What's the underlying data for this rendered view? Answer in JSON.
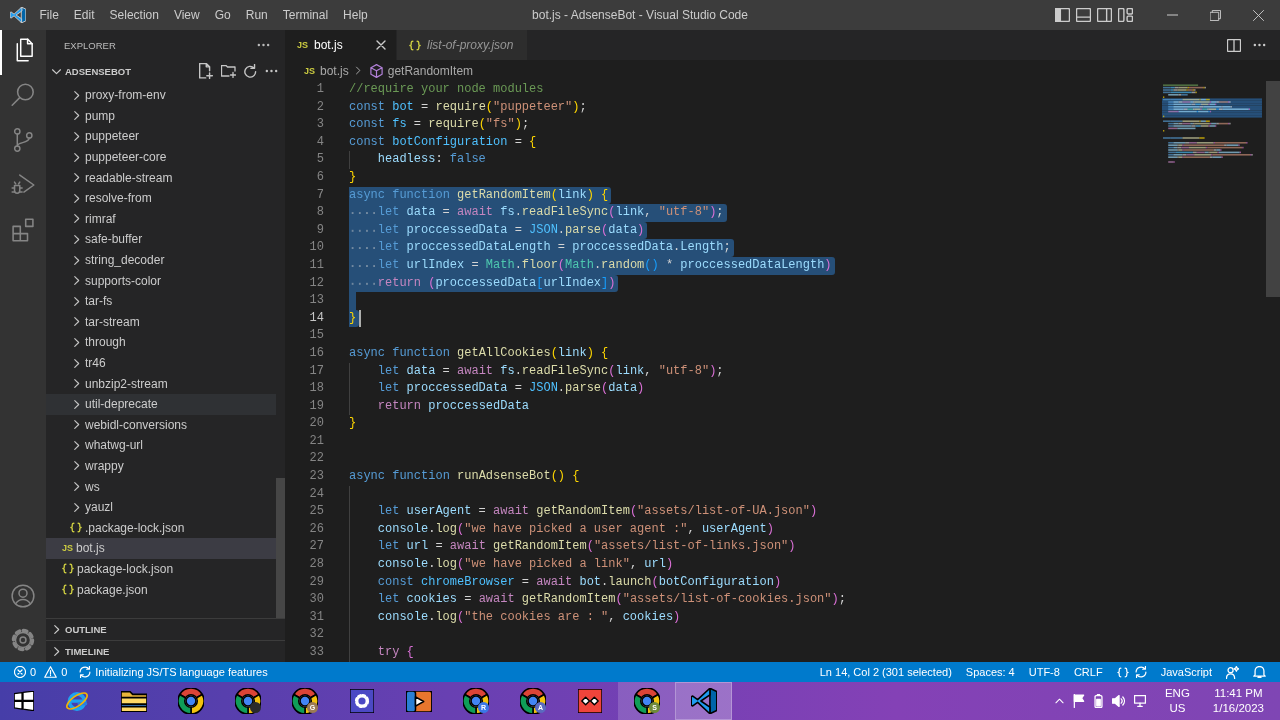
{
  "window": {
    "title": "bot.js - AdsenseBot - Visual Studio Code"
  },
  "menu": [
    "File",
    "Edit",
    "Selection",
    "View",
    "Go",
    "Run",
    "Terminal",
    "Help"
  ],
  "activity_bar": {
    "top": [
      {
        "kind": "explorer",
        "selected": true
      },
      {
        "kind": "search",
        "selected": false
      },
      {
        "kind": "source-control",
        "selected": false
      },
      {
        "kind": "run-debug",
        "selected": false
      },
      {
        "kind": "extensions",
        "selected": false
      }
    ],
    "bottom": [
      {
        "kind": "accounts",
        "selected": false
      },
      {
        "kind": "manage",
        "selected": false
      }
    ]
  },
  "sidebar": {
    "title": "EXPLORER",
    "sections": [
      {
        "title": "ADSENSEBOT",
        "expanded": true,
        "tree": [
          {
            "kind": "scrolled-parent",
            "children": [
              {
                "kind": "folder",
                "label": "proxy-from-env",
                "expanded": false,
                "selected": false,
                "hovered": false
              },
              {
                "kind": "folder",
                "label": "pump",
                "expanded": false,
                "selected": false,
                "hovered": false
              },
              {
                "kind": "folder",
                "label": "puppeteer",
                "expanded": false,
                "selected": false,
                "hovered": false
              },
              {
                "kind": "folder",
                "label": "puppeteer-core",
                "expanded": false,
                "selected": false,
                "hovered": false
              },
              {
                "kind": "folder",
                "label": "readable-stream",
                "expanded": false,
                "selected": false,
                "hovered": false
              },
              {
                "kind": "folder",
                "label": "resolve-from",
                "expanded": false,
                "selected": false,
                "hovered": false
              },
              {
                "kind": "folder",
                "label": "rimraf",
                "expanded": false,
                "selected": false,
                "hovered": false
              },
              {
                "kind": "folder",
                "label": "safe-buffer",
                "expanded": false,
                "selected": false,
                "hovered": false
              },
              {
                "kind": "folder",
                "label": "string_decoder",
                "expanded": false,
                "selected": false,
                "hovered": false
              },
              {
                "kind": "folder",
                "label": "supports-color",
                "expanded": false,
                "selected": false,
                "hovered": false
              },
              {
                "kind": "folder",
                "label": "tar-fs",
                "expanded": false,
                "selected": false,
                "hovered": false
              },
              {
                "kind": "folder",
                "label": "tar-stream",
                "expanded": false,
                "selected": false,
                "hovered": false
              },
              {
                "kind": "folder",
                "label": "through",
                "expanded": false,
                "selected": false,
                "hovered": false
              },
              {
                "kind": "folder",
                "label": "tr46",
                "expanded": false,
                "selected": false,
                "hovered": false
              },
              {
                "kind": "folder",
                "label": "unbzip2-stream",
                "expanded": false,
                "selected": false,
                "hovered": false
              },
              {
                "kind": "folder",
                "label": "util-deprecate",
                "expanded": false,
                "selected": false,
                "hovered": true
              },
              {
                "kind": "folder",
                "label": "webidl-conversions",
                "expanded": false,
                "selected": false,
                "hovered": false
              },
              {
                "kind": "folder",
                "label": "whatwg-url",
                "expanded": false,
                "selected": false,
                "hovered": false
              },
              {
                "kind": "folder",
                "label": "wrappy",
                "expanded": false,
                "selected": false,
                "hovered": false
              },
              {
                "kind": "folder",
                "label": "ws",
                "expanded": false,
                "selected": false,
                "hovered": false
              },
              {
                "kind": "folder",
                "label": "yauzl",
                "expanded": false,
                "selected": false,
                "hovered": false
              },
              {
                "kind": "json",
                "label": ".package-lock.json",
                "selected": false,
                "hovered": false
              }
            ]
          },
          {
            "kind": "js",
            "icon_label": "JS",
            "label": "bot.js",
            "selected": true,
            "hovered": false
          },
          {
            "kind": "json",
            "label": "package-lock.json",
            "selected": false,
            "hovered": false
          },
          {
            "kind": "json",
            "label": "package.json",
            "selected": false,
            "hovered": false
          }
        ]
      },
      {
        "title": "OUTLINE",
        "expanded": false
      },
      {
        "title": "TIMELINE",
        "expanded": false
      }
    ]
  },
  "editor": {
    "tabs": [
      {
        "kind": "js",
        "icon_label": "JS",
        "label": "bot.js",
        "selected": true,
        "preview": false
      },
      {
        "kind": "json",
        "label": "list-of-proxy.json",
        "selected": false,
        "preview": true
      }
    ],
    "breadcrumbs": [
      {
        "kind": "js",
        "icon_label": "JS",
        "label": "bot.js"
      },
      {
        "kind": "function",
        "label": "getRandomItem"
      }
    ],
    "lines": [
      {
        "number": "1",
        "indented": false,
        "selected": false,
        "current": false,
        "tokens": [
          {
            "kind": "comment",
            "text": "//require your node modules"
          }
        ]
      },
      {
        "number": "2",
        "indented": false,
        "selected": false,
        "current": false,
        "tokens": [
          {
            "kind": "storage",
            "text": "const "
          },
          {
            "kind": "constant",
            "text": "bot"
          },
          {
            "kind": "plain",
            "text": " = "
          },
          {
            "kind": "function",
            "text": "require"
          },
          {
            "kind": "bracket1",
            "text": "("
          },
          {
            "kind": "string",
            "text": "\"puppeteer\""
          },
          {
            "kind": "bracket1",
            "text": ")"
          },
          {
            "kind": "plain",
            "text": ";"
          }
        ]
      },
      {
        "number": "3",
        "indented": false,
        "selected": false,
        "current": false,
        "tokens": [
          {
            "kind": "storage",
            "text": "const "
          },
          {
            "kind": "constant",
            "text": "fs"
          },
          {
            "kind": "plain",
            "text": " = "
          },
          {
            "kind": "function",
            "text": "require"
          },
          {
            "kind": "bracket1",
            "text": "("
          },
          {
            "kind": "string",
            "text": "\"fs\""
          },
          {
            "kind": "bracket1",
            "text": ")"
          },
          {
            "kind": "plain",
            "text": ";"
          }
        ]
      },
      {
        "number": "4",
        "indented": false,
        "selected": false,
        "current": false,
        "tokens": [
          {
            "kind": "storage",
            "text": "const "
          },
          {
            "kind": "constant",
            "text": "botConfiguration"
          },
          {
            "kind": "plain",
            "text": " = "
          },
          {
            "kind": "bracket1",
            "text": "{"
          }
        ]
      },
      {
        "number": "5",
        "indented": true,
        "selected": false,
        "current": false,
        "tokens": [
          {
            "kind": "variable",
            "text": "headless"
          },
          {
            "kind": "plain",
            "text": ": "
          },
          {
            "kind": "storage",
            "text": "false"
          }
        ]
      },
      {
        "number": "6",
        "indented": false,
        "selected": false,
        "current": false,
        "tokens": [
          {
            "kind": "bracket1",
            "text": "}"
          }
        ]
      },
      {
        "number": "7",
        "indented": false,
        "selected": true,
        "current": false,
        "tokens": [
          {
            "kind": "storage",
            "text": "async "
          },
          {
            "kind": "storage",
            "text": "function "
          },
          {
            "kind": "function",
            "text": "getRandomItem"
          },
          {
            "kind": "bracket1",
            "text": "("
          },
          {
            "kind": "variable",
            "text": "link"
          },
          {
            "kind": "bracket1",
            "text": ") {"
          }
        ]
      },
      {
        "number": "8",
        "indented": true,
        "selected": true,
        "current": false,
        "tokens": [
          {
            "kind": "storage",
            "text": "let "
          },
          {
            "kind": "variable",
            "text": "data"
          },
          {
            "kind": "plain",
            "text": " = "
          },
          {
            "kind": "control",
            "text": "await "
          },
          {
            "kind": "variable",
            "text": "fs"
          },
          {
            "kind": "plain",
            "text": "."
          },
          {
            "kind": "function",
            "text": "readFileSync"
          },
          {
            "kind": "bracket2",
            "text": "("
          },
          {
            "kind": "variable",
            "text": "link"
          },
          {
            "kind": "plain",
            "text": ", "
          },
          {
            "kind": "string",
            "text": "\"utf-8\""
          },
          {
            "kind": "bracket2",
            "text": ")"
          },
          {
            "kind": "plain",
            "text": ";"
          }
        ]
      },
      {
        "number": "9",
        "indented": true,
        "selected": true,
        "current": false,
        "tokens": [
          {
            "kind": "storage",
            "text": "let "
          },
          {
            "kind": "variable",
            "text": "proccessedData"
          },
          {
            "kind": "plain",
            "text": " = "
          },
          {
            "kind": "constant",
            "text": "JSON"
          },
          {
            "kind": "plain",
            "text": "."
          },
          {
            "kind": "function",
            "text": "parse"
          },
          {
            "kind": "bracket2",
            "text": "("
          },
          {
            "kind": "variable",
            "text": "data"
          },
          {
            "kind": "bracket2",
            "text": ")"
          }
        ]
      },
      {
        "number": "10",
        "indented": true,
        "selected": true,
        "current": false,
        "tokens": [
          {
            "kind": "storage",
            "text": "let "
          },
          {
            "kind": "variable",
            "text": "proccessedDataLength"
          },
          {
            "kind": "plain",
            "text": " = "
          },
          {
            "kind": "variable",
            "text": "proccessedData"
          },
          {
            "kind": "plain",
            "text": "."
          },
          {
            "kind": "variable",
            "text": "Length"
          },
          {
            "kind": "plain",
            "text": ";"
          }
        ]
      },
      {
        "number": "11",
        "indented": true,
        "selected": true,
        "current": false,
        "tokens": [
          {
            "kind": "storage",
            "text": "let "
          },
          {
            "kind": "variable",
            "text": "urlIndex"
          },
          {
            "kind": "plain",
            "text": " = "
          },
          {
            "kind": "type",
            "text": "Math"
          },
          {
            "kind": "plain",
            "text": "."
          },
          {
            "kind": "function",
            "text": "floor"
          },
          {
            "kind": "bracket2",
            "text": "("
          },
          {
            "kind": "type",
            "text": "Math"
          },
          {
            "kind": "plain",
            "text": "."
          },
          {
            "kind": "function",
            "text": "random"
          },
          {
            "kind": "bracket3",
            "text": "()"
          },
          {
            "kind": "plain",
            "text": " * "
          },
          {
            "kind": "variable",
            "text": "proccessedDataLength"
          },
          {
            "kind": "bracket2",
            "text": ")"
          }
        ]
      },
      {
        "number": "12",
        "indented": true,
        "selected": true,
        "current": false,
        "tokens": [
          {
            "kind": "control",
            "text": "return "
          },
          {
            "kind": "bracket2",
            "text": "("
          },
          {
            "kind": "variable",
            "text": "proccessedData"
          },
          {
            "kind": "bracket3",
            "text": "["
          },
          {
            "kind": "variable",
            "text": "urlIndex"
          },
          {
            "kind": "bracket3",
            "text": "]"
          },
          {
            "kind": "bracket2",
            "text": ")"
          }
        ]
      },
      {
        "number": "13",
        "indented": false,
        "selected": true,
        "current": false
      },
      {
        "number": "14",
        "indented": false,
        "selected": true,
        "current": true,
        "tokens": [
          {
            "kind": "bracket1",
            "text": "}"
          }
        ]
      },
      {
        "number": "15",
        "indented": false,
        "selected": false,
        "current": false
      },
      {
        "number": "16",
        "indented": false,
        "selected": false,
        "current": false,
        "tokens": [
          {
            "kind": "storage",
            "text": "async "
          },
          {
            "kind": "storage",
            "text": "function "
          },
          {
            "kind": "function",
            "text": "getAllCookies"
          },
          {
            "kind": "bracket1",
            "text": "("
          },
          {
            "kind": "variable",
            "text": "link"
          },
          {
            "kind": "bracket1",
            "text": ") {"
          }
        ]
      },
      {
        "number": "17",
        "indented": true,
        "selected": false,
        "current": false,
        "tokens": [
          {
            "kind": "storage",
            "text": "let "
          },
          {
            "kind": "variable",
            "text": "data"
          },
          {
            "kind": "plain",
            "text": " = "
          },
          {
            "kind": "control",
            "text": "await "
          },
          {
            "kind": "variable",
            "text": "fs"
          },
          {
            "kind": "plain",
            "text": "."
          },
          {
            "kind": "function",
            "text": "readFileSync"
          },
          {
            "kind": "bracket2",
            "text": "("
          },
          {
            "kind": "variable",
            "text": "link"
          },
          {
            "kind": "plain",
            "text": ", "
          },
          {
            "kind": "string",
            "text": "\"utf-8\""
          },
          {
            "kind": "bracket2",
            "text": ")"
          },
          {
            "kind": "plain",
            "text": ";"
          }
        ]
      },
      {
        "number": "18",
        "indented": true,
        "selected": false,
        "current": false,
        "tokens": [
          {
            "kind": "storage",
            "text": "let "
          },
          {
            "kind": "variable",
            "text": "proccessedData"
          },
          {
            "kind": "plain",
            "text": " = "
          },
          {
            "kind": "constant",
            "text": "JSON"
          },
          {
            "kind": "plain",
            "text": "."
          },
          {
            "kind": "function",
            "text": "parse"
          },
          {
            "kind": "bracket2",
            "text": "("
          },
          {
            "kind": "variable",
            "text": "data"
          },
          {
            "kind": "bracket2",
            "text": ")"
          }
        ]
      },
      {
        "number": "19",
        "indented": true,
        "selected": false,
        "current": false,
        "tokens": [
          {
            "kind": "control",
            "text": "return "
          },
          {
            "kind": "variable",
            "text": "proccessedData"
          }
        ]
      },
      {
        "number": "20",
        "indented": false,
        "selected": false,
        "current": false,
        "tokens": [
          {
            "kind": "bracket1",
            "text": "}"
          }
        ]
      },
      {
        "number": "21",
        "indented": false,
        "selected": false,
        "current": false
      },
      {
        "number": "22",
        "indented": false,
        "selected": false,
        "current": false
      },
      {
        "number": "23",
        "indented": false,
        "selected": false,
        "current": false,
        "tokens": [
          {
            "kind": "storage",
            "text": "async "
          },
          {
            "kind": "storage",
            "text": "function "
          },
          {
            "kind": "function",
            "text": "runAdsenseBot"
          },
          {
            "kind": "bracket1",
            "text": "() {"
          }
        ]
      },
      {
        "number": "24",
        "indented": true,
        "selected": false,
        "current": false
      },
      {
        "number": "25",
        "indented": true,
        "selected": false,
        "current": false,
        "tokens": [
          {
            "kind": "storage",
            "text": "let "
          },
          {
            "kind": "variable",
            "text": "userAgent"
          },
          {
            "kind": "plain",
            "text": " = "
          },
          {
            "kind": "control",
            "text": "await "
          },
          {
            "kind": "function",
            "text": "getRandomItem"
          },
          {
            "kind": "bracket2",
            "text": "("
          },
          {
            "kind": "string",
            "text": "\"assets/list-of-UA.json\""
          },
          {
            "kind": "bracket2",
            "text": ")"
          }
        ]
      },
      {
        "number": "26",
        "indented": true,
        "selected": false,
        "current": false,
        "tokens": [
          {
            "kind": "variable",
            "text": "console"
          },
          {
            "kind": "plain",
            "text": "."
          },
          {
            "kind": "function",
            "text": "log"
          },
          {
            "kind": "bracket2",
            "text": "("
          },
          {
            "kind": "string",
            "text": "\"we have picked a user agent :\""
          },
          {
            "kind": "plain",
            "text": ", "
          },
          {
            "kind": "variable",
            "text": "userAgent"
          },
          {
            "kind": "bracket2",
            "text": ")"
          }
        ]
      },
      {
        "number": "27",
        "indented": true,
        "selected": false,
        "current": false,
        "tokens": [
          {
            "kind": "storage",
            "text": "let "
          },
          {
            "kind": "variable",
            "text": "url"
          },
          {
            "kind": "plain",
            "text": " = "
          },
          {
            "kind": "control",
            "text": "await "
          },
          {
            "kind": "function",
            "text": "getRandomItem"
          },
          {
            "kind": "bracket2",
            "text": "("
          },
          {
            "kind": "string",
            "text": "\"assets/list-of-links.json\""
          },
          {
            "kind": "bracket2",
            "text": ")"
          }
        ]
      },
      {
        "number": "28",
        "indented": true,
        "selected": false,
        "current": false,
        "tokens": [
          {
            "kind": "variable",
            "text": "console"
          },
          {
            "kind": "plain",
            "text": "."
          },
          {
            "kind": "function",
            "text": "log"
          },
          {
            "kind": "bracket2",
            "text": "("
          },
          {
            "kind": "string",
            "text": "\"we have picked a link\""
          },
          {
            "kind": "plain",
            "text": ", "
          },
          {
            "kind": "variable",
            "text": "url"
          },
          {
            "kind": "bracket2",
            "text": ")"
          }
        ]
      },
      {
        "number": "29",
        "indented": true,
        "selected": false,
        "current": false,
        "tokens": [
          {
            "kind": "storage",
            "text": "const "
          },
          {
            "kind": "constant",
            "text": "chromeBrowser"
          },
          {
            "kind": "plain",
            "text": " = "
          },
          {
            "kind": "control",
            "text": "await "
          },
          {
            "kind": "variable",
            "text": "bot"
          },
          {
            "kind": "plain",
            "text": "."
          },
          {
            "kind": "function",
            "text": "launch"
          },
          {
            "kind": "bracket2",
            "text": "("
          },
          {
            "kind": "variable",
            "text": "botConfiguration"
          },
          {
            "kind": "bracket2",
            "text": ")"
          }
        ]
      },
      {
        "number": "30",
        "indented": true,
        "selected": false,
        "current": false,
        "tokens": [
          {
            "kind": "storage",
            "text": "let "
          },
          {
            "kind": "variable",
            "text": "cookies"
          },
          {
            "kind": "plain",
            "text": " = "
          },
          {
            "kind": "control",
            "text": "await "
          },
          {
            "kind": "function",
            "text": "getRandomItem"
          },
          {
            "kind": "bracket2",
            "text": "("
          },
          {
            "kind": "string",
            "text": "\"assets/list-of-cookies.json\""
          },
          {
            "kind": "bracket2",
            "text": ")"
          },
          {
            "kind": "plain",
            "text": ";"
          }
        ]
      },
      {
        "number": "31",
        "indented": true,
        "selected": false,
        "current": false,
        "tokens": [
          {
            "kind": "variable",
            "text": "console"
          },
          {
            "kind": "plain",
            "text": "."
          },
          {
            "kind": "function",
            "text": "log"
          },
          {
            "kind": "bracket2",
            "text": "("
          },
          {
            "kind": "string",
            "text": "\"the cookies are : \""
          },
          {
            "kind": "plain",
            "text": ", "
          },
          {
            "kind": "variable",
            "text": "cookies"
          },
          {
            "kind": "bracket2",
            "text": ")"
          }
        ]
      },
      {
        "number": "32",
        "indented": true,
        "selected": false,
        "current": false
      },
      {
        "number": "33",
        "indented": true,
        "selected": false,
        "current": false,
        "tokens": [
          {
            "kind": "control",
            "text": "try "
          },
          {
            "kind": "bracket2",
            "text": "{"
          }
        ]
      }
    ]
  },
  "status_bar": {
    "left": [
      {
        "kind": "problems",
        "errors": "0",
        "warnings": "0"
      },
      {
        "kind": "progress",
        "text": "Initializing JS/TS language features"
      }
    ],
    "right": [
      {
        "kind": "text",
        "text": "Ln 14, Col 2 (301 selected)"
      },
      {
        "kind": "text",
        "text": "Spaces: 4"
      },
      {
        "kind": "text",
        "text": "UTF-8"
      },
      {
        "kind": "text",
        "text": "CRLF"
      },
      {
        "kind": "language-status",
        "busy": true
      },
      {
        "kind": "text",
        "text": "JavaScript"
      },
      {
        "kind": "feedback"
      },
      {
        "kind": "notifications"
      }
    ]
  },
  "taskbar": {
    "apps": [
      {
        "kind": "start",
        "selected": false,
        "open": false
      },
      {
        "kind": "web-browser",
        "selected": false,
        "open": false
      },
      {
        "kind": "file-manager",
        "selected": false,
        "open": false
      },
      {
        "kind": "chrome",
        "selected": false,
        "open": false
      },
      {
        "kind": "chrome",
        "selected": false,
        "open": false,
        "badge": {
          "kind": "photo"
        }
      },
      {
        "kind": "chrome",
        "selected": false,
        "open": false,
        "badge": {
          "kind": "letter",
          "text": "G",
          "color": "#9c7a54"
        }
      },
      {
        "kind": "settings",
        "selected": false,
        "open": false
      },
      {
        "kind": "media-player",
        "selected": false,
        "open": false
      },
      {
        "kind": "chrome",
        "selected": false,
        "open": false,
        "badge": {
          "kind": "letter",
          "text": "R",
          "color": "#3b78e7"
        }
      },
      {
        "kind": "chrome",
        "selected": false,
        "open": false,
        "badge": {
          "kind": "letter",
          "text": "A",
          "color": "#5b6abf"
        }
      },
      {
        "kind": "app",
        "selected": false,
        "open": false
      },
      {
        "kind": "chrome",
        "selected": false,
        "open": true,
        "badge": {
          "kind": "letter",
          "text": "S",
          "color": "#6f8a3a"
        }
      },
      {
        "kind": "code-editor",
        "selected": true,
        "open": true
      }
    ],
    "tray": {
      "language": "ENG",
      "region": "US",
      "time": "11:41 PM",
      "date": "1/16/2023"
    }
  }
}
